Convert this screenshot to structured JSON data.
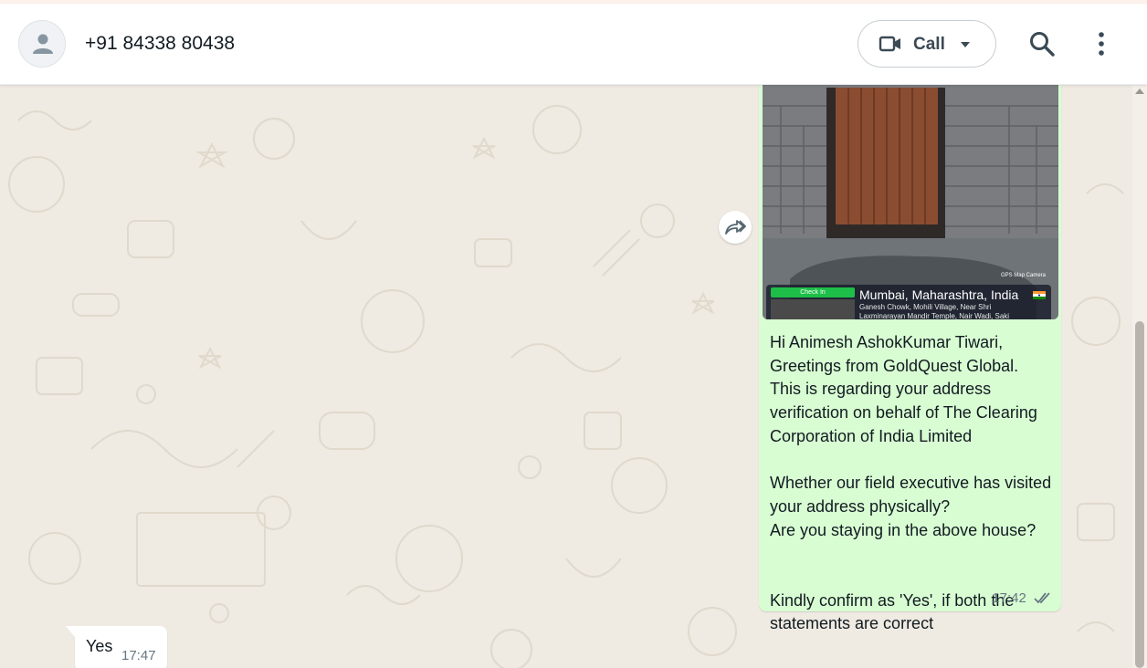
{
  "header": {
    "contact_name": "+91 84338 80438",
    "call_label": "Call",
    "icons": [
      "default-avatar-icon",
      "video-call-icon",
      "chevron-down-icon",
      "search-icon",
      "more-options-icon"
    ]
  },
  "messages": {
    "outgoing": {
      "image": {
        "check_in_label": "Check In",
        "location_title": "Mumbai, Maharashtra, India",
        "address_line1": "Ganesh Chowk, Mohili Village, Near Shri",
        "address_line2": "Laxminarayan Mandir Temple, Nair Wadi, Saki"
      },
      "text": "Hi Animesh AshokKumar Tiwari,\nGreetings from GoldQuest Global.\nThis is regarding your address verification on behalf of The Clearing Corporation of India Limited\n\nWhether our field executive has visited your address physically?\nAre you staying in the above house?\n\n\nKindly confirm as 'Yes', if both the statements are correct",
      "time": "17:42",
      "status": "read"
    },
    "incoming": {
      "text": "Yes",
      "time": "17:47"
    }
  },
  "colors": {
    "chat_bg": "#efeae2",
    "outgoing_bubble": "#d9fdd3",
    "incoming_bubble": "#ffffff",
    "checkin_green": "#1dbf48"
  }
}
